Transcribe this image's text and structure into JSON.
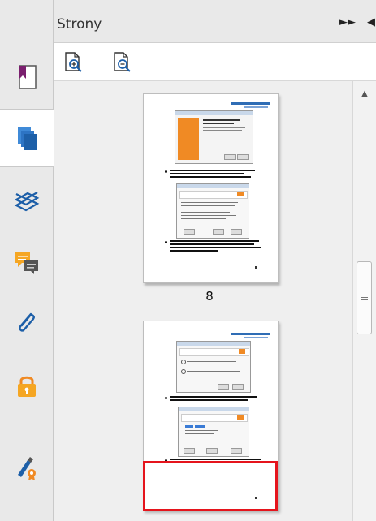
{
  "panel": {
    "title": "Strony",
    "controls": [
      "expand-panel",
      "collapse-panel"
    ]
  },
  "toolbar": {
    "buttons": [
      {
        "name": "enlarge-thumbnails",
        "icon": "zoom-in-page-icon"
      },
      {
        "name": "reduce-thumbnails",
        "icon": "zoom-out-page-icon"
      }
    ]
  },
  "sidebar": {
    "items": [
      {
        "name": "bookmarks",
        "icon": "bookmark-icon",
        "active": false
      },
      {
        "name": "pages",
        "icon": "pages-icon",
        "active": true
      },
      {
        "name": "layers",
        "icon": "layers-icon",
        "active": false
      },
      {
        "name": "comments",
        "icon": "comments-icon",
        "active": false
      },
      {
        "name": "attachments",
        "icon": "paperclip-icon",
        "active": false
      },
      {
        "name": "security",
        "icon": "lock-icon",
        "active": false
      },
      {
        "name": "signatures",
        "icon": "signature-icon",
        "active": false
      }
    ]
  },
  "pages": [
    {
      "number": "8",
      "selected": false
    },
    {
      "number": "",
      "selected": false
    }
  ],
  "colors": {
    "accent_orange": "#f08a24",
    "icon_blue": "#1d5fa8",
    "selection_red": "#e5141c",
    "link_blue": "#2f6db5"
  }
}
